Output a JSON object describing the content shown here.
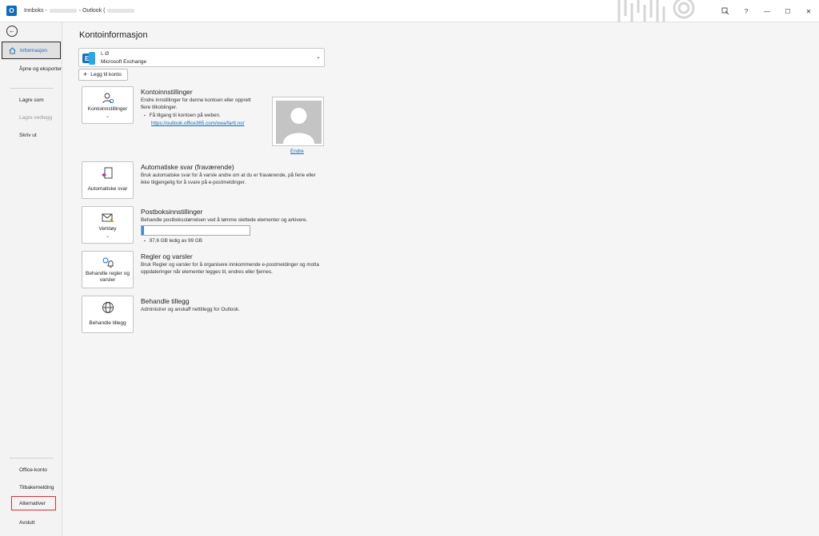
{
  "titlebar": {
    "app_icon": "outlook-icon",
    "title_prefix": "Innboks -",
    "title_suffix": "- Outlook (",
    "controls": [
      "coauthor-icon",
      "?",
      "—",
      "☐",
      "✕"
    ]
  },
  "sidebar": {
    "back_icon": "back-arrow-icon",
    "items": [
      {
        "label": "Informasjon",
        "active": true
      },
      {
        "label": "Åpne og eksporter"
      },
      {
        "label": "Lagre som"
      },
      {
        "label": "Lagre vedlegg",
        "disabled": true
      },
      {
        "label": "Skriv ut"
      },
      {
        "label": "Office-konto"
      },
      {
        "label": "Tilbakemelding"
      },
      {
        "label": "Alternativer",
        "highlighted": true
      },
      {
        "label": "Avslutt"
      }
    ]
  },
  "main": {
    "title": "Kontoinformasjon",
    "account": {
      "name": "L    Ø",
      "type": "Microsoft Exchange"
    },
    "add_account_label": "Legg til konto",
    "sections": {
      "account_settings": {
        "tile_label": "Kontoinnstillinger",
        "title": "Kontoinnstillinger",
        "desc": "Endre innstillinger for denne kontoen eller opprett flere tilkoblinger.",
        "bullet": "Få tilgang til kontoen på weben.",
        "link": "https://outlook.office365.com/owa/fartt.no/"
      },
      "auto_reply": {
        "tile_label": "Automatiske svar",
        "title": "Automatiske svar (fraværende)",
        "desc": "Bruk automatiske svar for å varsle andre om at du er fraværende, på ferie eller ikke tilgjengelig for å svare på e-postmeldinger."
      },
      "mailbox": {
        "tile_label": "Verktøy",
        "title": "Postboksinnstillinger",
        "desc": "Behandle postboksstørrelsen ved å tømme slettede elementer og arkivere.",
        "quota_text": "97,6 GB ledig av 99 GB",
        "used_fraction": 0.014
      },
      "rules": {
        "tile_label": "Behandle regler og varsler",
        "title": "Regler og varsler",
        "desc": "Bruk Regler og varsler for å organisere innkommende e-postmeldinger og motta oppdateringer når elementer legges til, endres eller fjernes."
      },
      "addins": {
        "tile_label": "Behandle tillegg",
        "title": "Behandle tillegg",
        "desc": "Administrer og anskaff nettillegg for Outlook."
      }
    },
    "photo_change_label": "Endre"
  }
}
